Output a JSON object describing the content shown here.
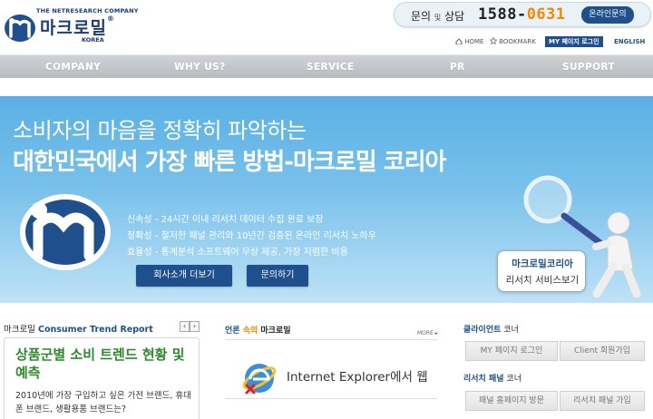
{
  "header": {
    "logo_tag": "THE NETRESEARCH COMPANY",
    "logo_name": "마크로밀",
    "logo_reg": "®",
    "logo_korea": "KOREA",
    "call_label": "문의",
    "call_label_small": "및",
    "call_label_tail": "상담",
    "call_number_main": "1588-",
    "call_number_accent": "0631",
    "inquiry_button": "온라인문의",
    "util": {
      "home": "HOME",
      "bookmark": "BOOKMARK",
      "mypage_login": "MY 페이지 로그인",
      "english": "ENGLISH"
    }
  },
  "nav": {
    "items": [
      "COMPANY",
      "WHY US?",
      "SERVICE",
      "PR",
      "SUPPORT"
    ]
  },
  "hero": {
    "line1": "소비자의 마음을 정확히 파악하는",
    "line2": "대한민국에서 가장 빠른 방법-마크로밀 코리아",
    "features": [
      "신속성 - 24시간 이내 리서치 데이터 수집 완료 보장",
      "정확성 - 철저한 패널 관리와 10년간 검증된 온라인 리서치 노하우",
      "효율성 - 통계분석 소프트웨어 무상 제공, 가장 저렴한 비용"
    ],
    "btn_company": "회사소개 더보기",
    "btn_inquiry": "문의하기",
    "speech_line1": "마크로밀코리아",
    "speech_line2": "리서치 서비스보기"
  },
  "trend": {
    "head_prefix": "마크로밀",
    "head_accent": "Consumer Trend Report",
    "prev": "‹",
    "next": "›",
    "title": "상품군별 소비 트렌드 현황 및 예측",
    "text": "2010년에 가장 구입하고 싶은 가전 브랜드, 휴대폰 브랜드, 생활용품 브랜드는?"
  },
  "press": {
    "head_prefix": "언론",
    "head_mid": "속의",
    "head_tail": "마크로밀",
    "more": "MORE",
    "item_text": "Internet Explorer에서 웹"
  },
  "client": {
    "head_accent": "클라이언트",
    "head_tail": "코너",
    "btn_mypage": "MY 페이지 로그인",
    "btn_signup": "Client 회원가입"
  },
  "panel": {
    "head_accent": "리서치 패널",
    "head_tail": "코너",
    "btn_visit": "패널 홈페이지 방문",
    "btn_join": "리서치 패널 가입"
  },
  "colors": {
    "brand_navy": "#1f4f8c",
    "accent_orange": "#f08a00",
    "trend_green": "#2c8a2c",
    "hero_blue": "#5ab0e4"
  }
}
